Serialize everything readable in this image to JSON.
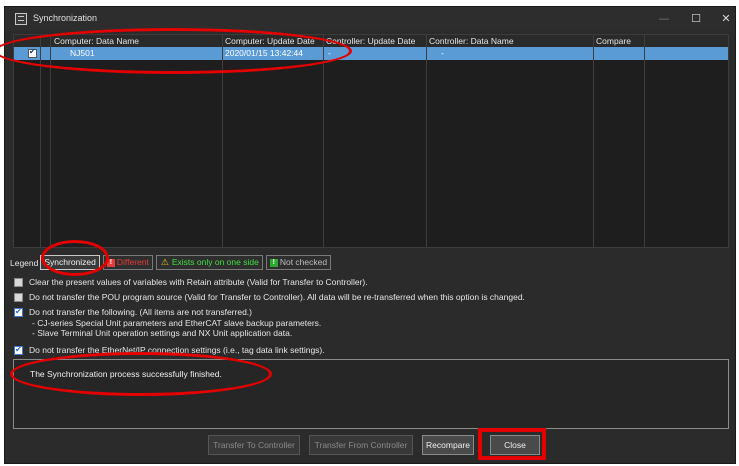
{
  "window": {
    "title": "Synchronization",
    "min_glyph": "—",
    "max_glyph": "☐",
    "close_glyph": "✕"
  },
  "table": {
    "columns": [
      "Computer: Data Name",
      "Computer: Update Date",
      "Controller: Update Date",
      "Controller: Data Name",
      "Compare"
    ],
    "rows": [
      {
        "checked": true,
        "computer_data_name": "NJ501",
        "computer_update_date": "2020/01/15 13:42:44",
        "controller_update_date": "-",
        "controller_data_name": "-",
        "compare": ""
      }
    ]
  },
  "legend": {
    "label": "Legend",
    "synchronized": "Synchronized",
    "different": "Different",
    "one_side": "Exists only on one side",
    "not_checked": "Not checked",
    "different_mark": "!",
    "one_side_mark": "⚠",
    "not_checked_mark": "!"
  },
  "options": {
    "retain": {
      "checked": false,
      "label": "Clear the present values of variables with Retain attribute (Valid for Transfer to Controller)."
    },
    "pou": {
      "checked": false,
      "label": "Do not transfer the POU program source (Valid for Transfer to Controller). All data will be re-transferred when this option is changed."
    },
    "following": {
      "checked": true,
      "label": "Do not transfer the following. (All items are not transferred.)",
      "sub1": "- CJ-series Special Unit parameters and EtherCAT slave backup parameters.",
      "sub2": "- Slave Terminal Unit operation settings and NX Unit application data."
    },
    "ethernetip": {
      "checked": true,
      "label": "Do not transfer the EtherNet/IP connection settings (i.e., tag data link settings)."
    }
  },
  "message": "The Synchronization process successfully finished.",
  "buttons": {
    "transfer_to": "Transfer To Controller",
    "transfer_from": "Transfer From Controller",
    "recompare": "Recompare",
    "close": "Close"
  },
  "colors": {
    "selection": "#5a9bd5",
    "annotation": "#e50000",
    "different": "#e63b3b",
    "one_side": "#3fe03f"
  }
}
